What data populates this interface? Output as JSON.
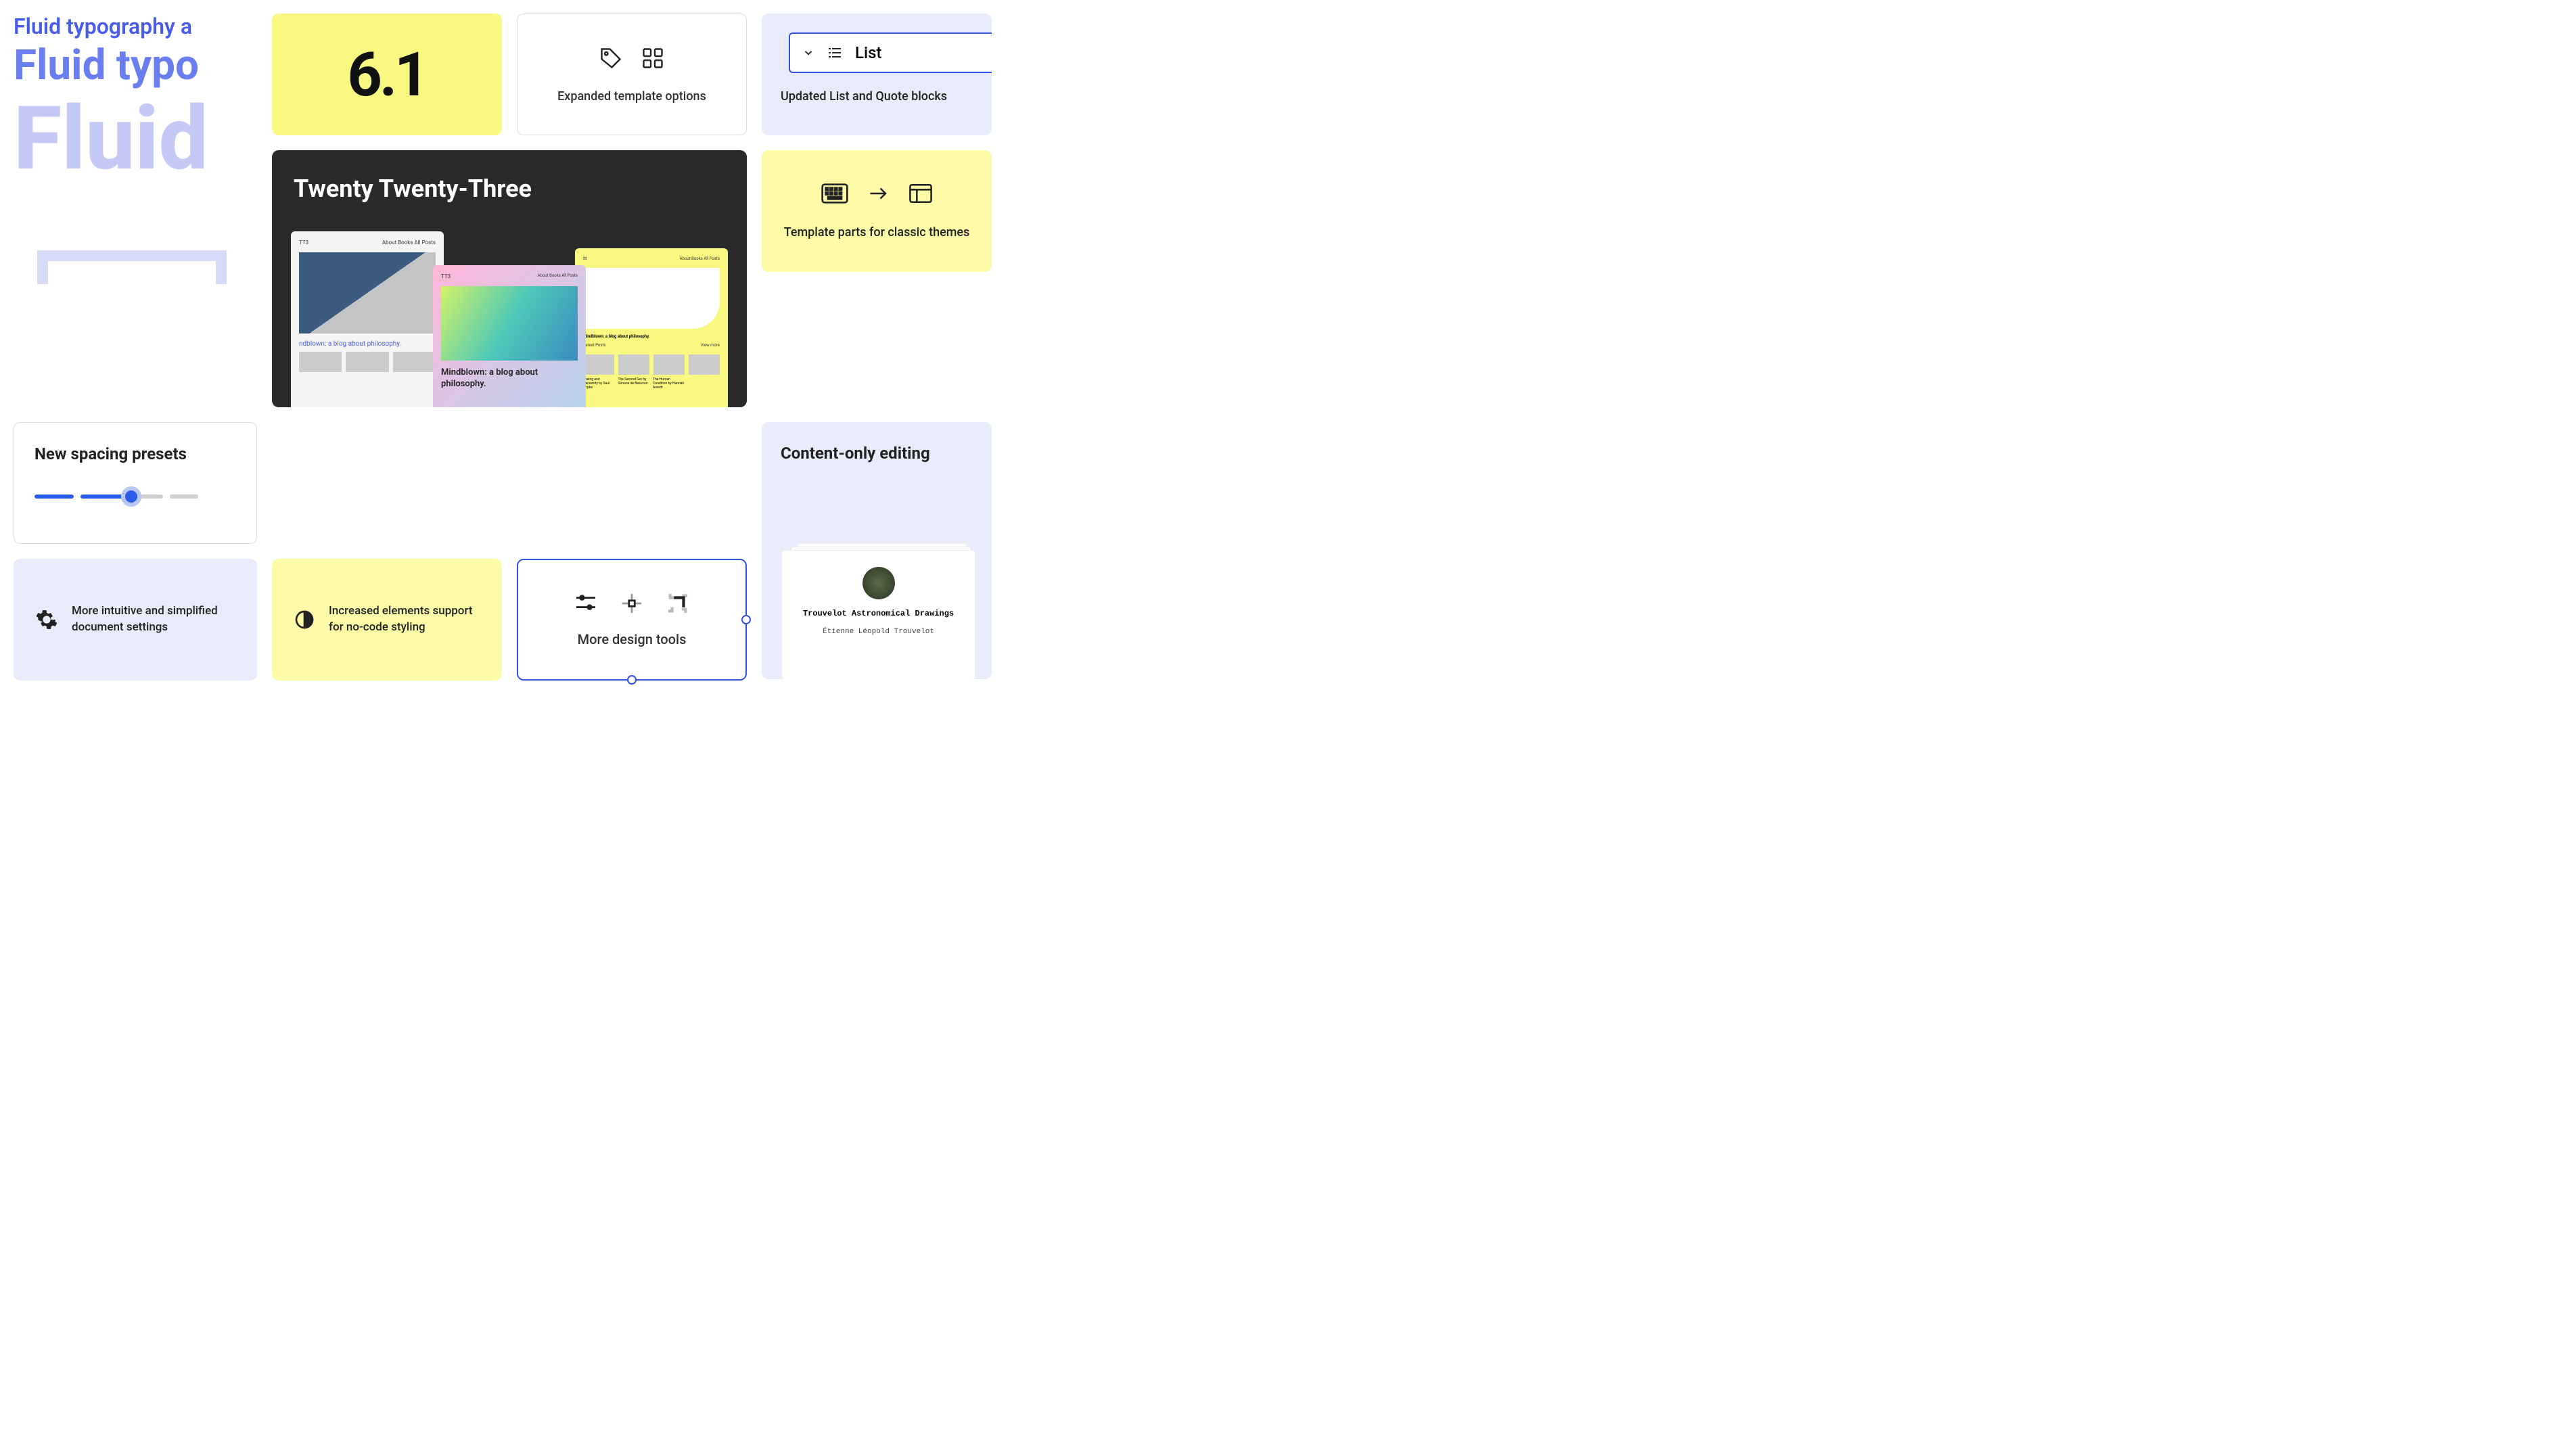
{
  "fluid": {
    "line1": "Fluid typography a",
    "line2": "Fluid typo",
    "line3": "Fluid"
  },
  "version": {
    "number": "6.1"
  },
  "template": {
    "label": "Expanded template options"
  },
  "list": {
    "select_label": "List",
    "caption": "Updated List and Quote blocks"
  },
  "tt3": {
    "title": "Twenty Twenty-Three",
    "nav_site": "TT3",
    "nav_links": "About  Books  All Posts",
    "shot1_text": "Mindblown: a blog about philosophy.",
    "shot2_text": "ndblown: a blog about philosophy.",
    "shot3_text": "Mindblown: a blog about philosophy.",
    "latest": "Latest Posts",
    "view_more": "View more"
  },
  "spacing": {
    "title": "New spacing presets"
  },
  "tparts": {
    "label": "Template parts for classic themes"
  },
  "content": {
    "title": "Content-only editing",
    "card_title": "Trouvelot Astronomical Drawings",
    "card_sub": "Étienne Léopold Trouvelot"
  },
  "doc": {
    "text": "More intuitive and simplified document settings"
  },
  "nocode": {
    "text": "Increased elements support for no-code styling"
  },
  "design": {
    "label": "More design tools"
  }
}
